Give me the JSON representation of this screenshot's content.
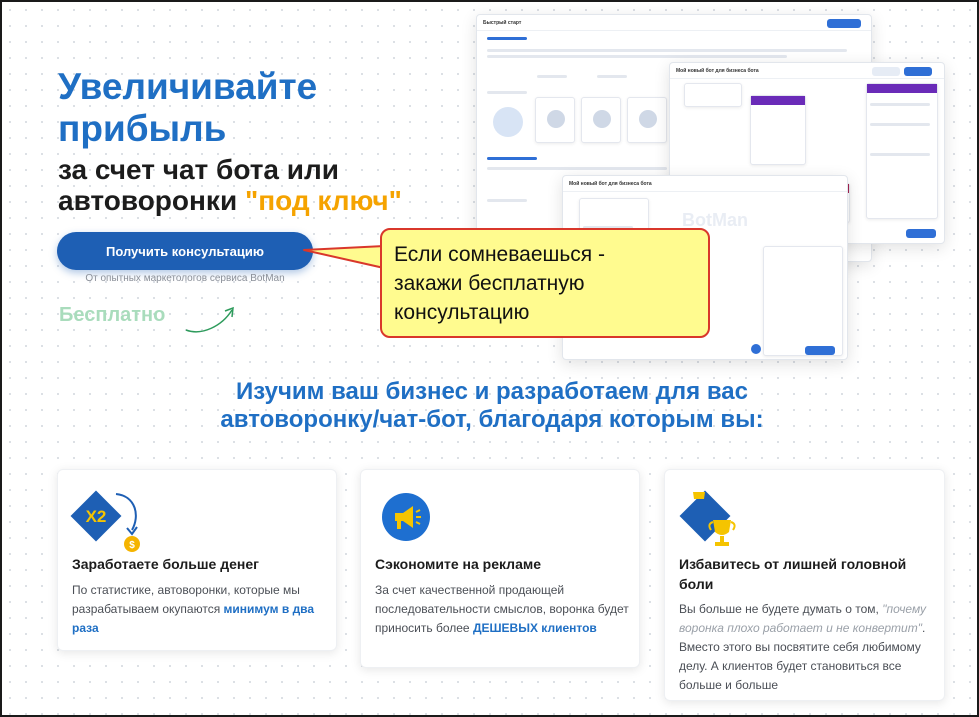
{
  "hero": {
    "title_line1": "Увеличивайте",
    "title_line2": "прибыль",
    "sub_line1": "за счет чат бота или",
    "sub_line2_start": "автоворонки ",
    "sub_line2_accent": "\"под ключ\"",
    "cta_label": "Получить консультацию",
    "cta_note": "От опытных маркетологов сервиса BotMan",
    "free_label": "Бесплатно"
  },
  "mockup": {
    "quick_start": "Быстрый старт",
    "bot_title": "Мой новый бот для бизнеса бота",
    "watermark": "BotMan"
  },
  "callout": {
    "line1": "Если сомневаешься -",
    "line2": "закажи бесплатную",
    "line3": "консультацию"
  },
  "section": {
    "title_line1": "Изучим ваш бизнес и разработаем для вас",
    "title_line2": "автоворонку/чат-бот, благодаря которым вы:"
  },
  "cards": [
    {
      "icon": "x2-growth-icon",
      "title": "Заработаете больше денег",
      "text_a": "По статистике, автоворонки, которые мы разрабатываем окупаются ",
      "text_bold": "минимум в два раза",
      "text_b": ""
    },
    {
      "icon": "megaphone-icon",
      "title": "Сэкономите на рекламе",
      "text_a": "За счет качественной продающей последовательности смыслов, воронка будет приносить более ",
      "text_bold": "ДЕШЕВЫХ клиентов",
      "text_b": ""
    },
    {
      "icon": "trophy-icon",
      "title_line1": "Избавитесь от лишней головной",
      "title_line2": "боли",
      "text_a": "Вы больше не будете думать о том, ",
      "text_italic": "\"почему воронка плохо работает и не конвертит\"",
      "text_b": ". Вместо этого вы посвятите себя любимому делу. А клиентов будет становиться все больше и больше"
    }
  ],
  "colors": {
    "brand_blue": "#1f6fc4",
    "cta_blue": "#1e5fb4",
    "accent_orange": "#f5a300",
    "free_green": "#a9dcbc",
    "callout_yellow": "#fffb8f",
    "callout_border": "#d9372b"
  }
}
